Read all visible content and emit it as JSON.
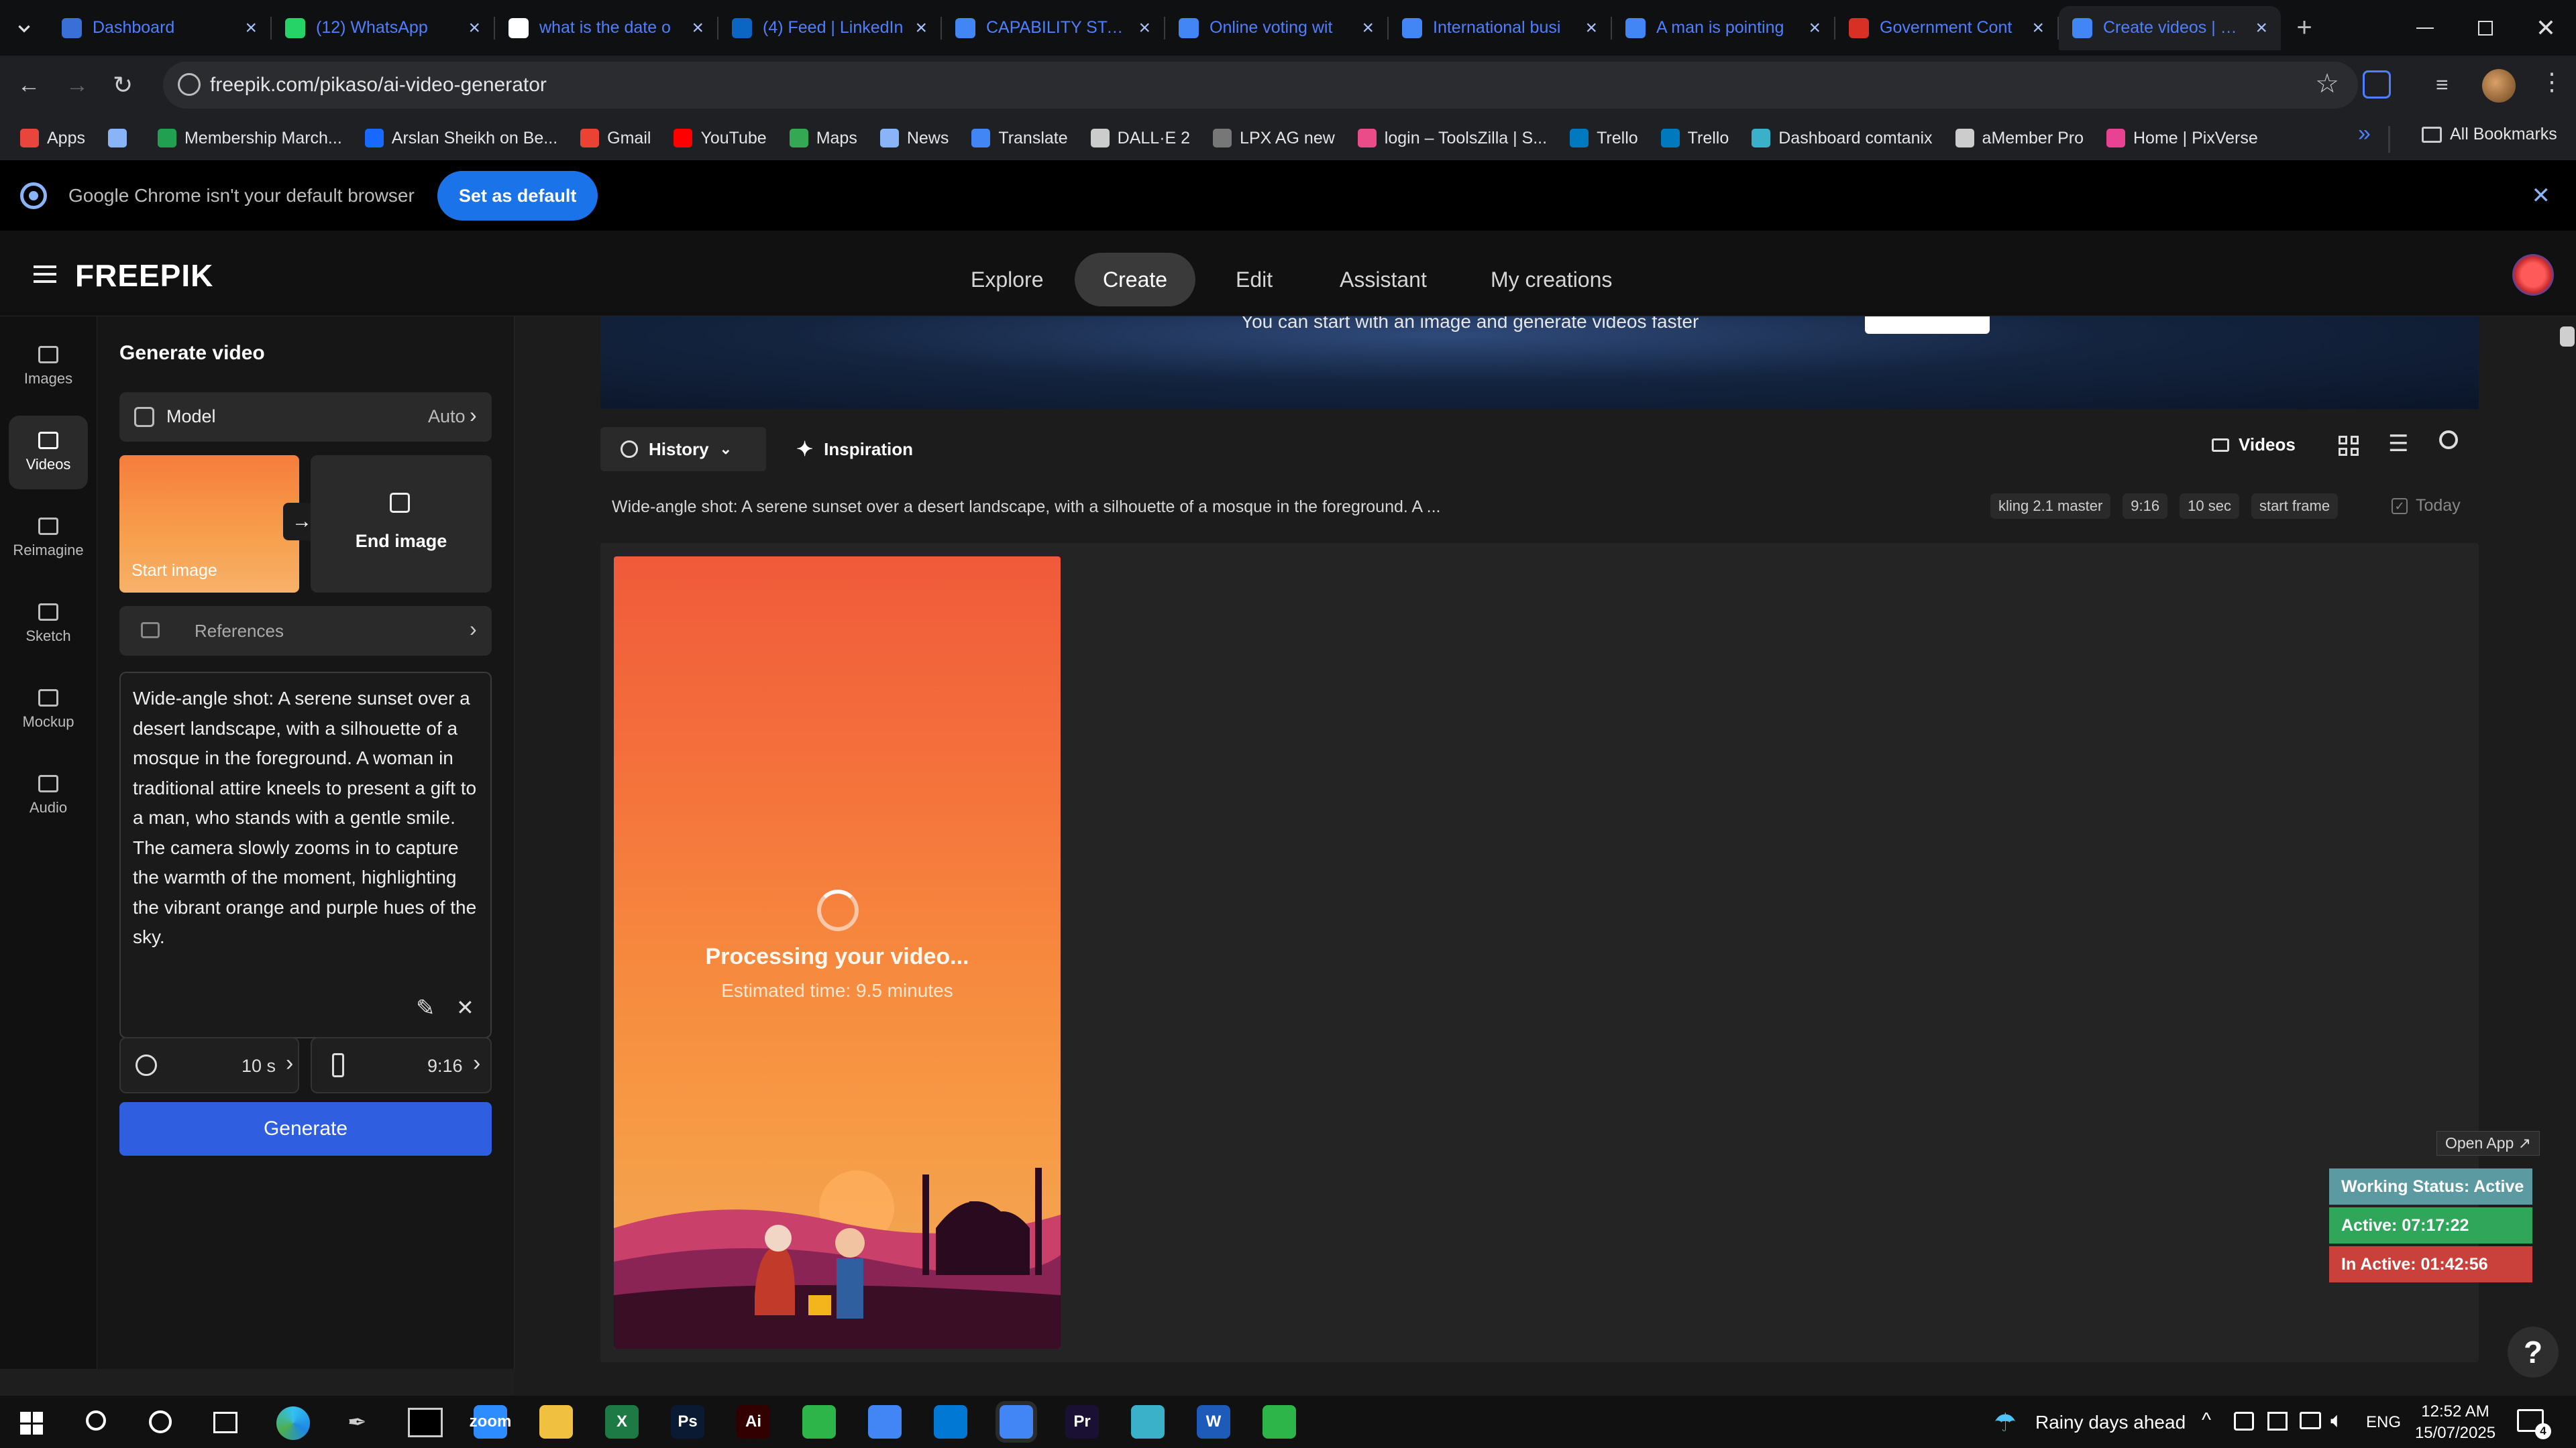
{
  "browser": {
    "tabs": [
      {
        "title": "Dashboard",
        "favicon_color": "#3b6fd8"
      },
      {
        "title": "(12) WhatsApp",
        "favicon_color": "#25d366"
      },
      {
        "title": "what is the date o",
        "favicon_color": "#ffffff"
      },
      {
        "title": "(4) Feed | LinkedIn",
        "favicon_color": "#0a66c2"
      },
      {
        "title": "CAPABILITY STATE",
        "favicon_color": "#4285f4"
      },
      {
        "title": "Online voting wit",
        "favicon_color": "#4285f4"
      },
      {
        "title": "International busi",
        "favicon_color": "#4285f4"
      },
      {
        "title": "A man is pointing",
        "favicon_color": "#4285f4"
      },
      {
        "title": "Government Cont",
        "favicon_color": "#d93025"
      },
      {
        "title": "Create videos | Fre",
        "favicon_color": "#4285f4"
      }
    ],
    "url": "freepik.com/pikaso/ai-video-generator",
    "bookmarks": [
      {
        "label": "Apps",
        "color": "#e8453c"
      },
      {
        "label": "",
        "color": "#8ab4f8"
      },
      {
        "label": "Membership March...",
        "color": "#22a052"
      },
      {
        "label": "Arslan Sheikh on Be...",
        "color": "#1769ff"
      },
      {
        "label": "Gmail",
        "color": "#ea4335"
      },
      {
        "label": "YouTube",
        "color": "#ff0000"
      },
      {
        "label": "Maps",
        "color": "#34a853"
      },
      {
        "label": "News",
        "color": "#8ab4f8"
      },
      {
        "label": "Translate",
        "color": "#4285f4"
      },
      {
        "label": "DALL·E 2",
        "color": "#cccccc"
      },
      {
        "label": "LPX AG new",
        "color": "#777777"
      },
      {
        "label": "login – ToolsZilla | S...",
        "color": "#e94c89"
      },
      {
        "label": "Trello",
        "color": "#0079bf"
      },
      {
        "label": "Trello",
        "color": "#0079bf"
      },
      {
        "label": "Dashboard comtanix",
        "color": "#3ab0c9"
      },
      {
        "label": "aMember Pro",
        "color": "#cccccc"
      },
      {
        "label": "Home | PixVerse",
        "color": "#e84393"
      }
    ],
    "all_bookmarks": "All Bookmarks",
    "notice_text": "Google Chrome isn't your default browser",
    "notice_button": "Set as default"
  },
  "header": {
    "logo": "FREEPIK",
    "nav": [
      "Explore",
      "Create",
      "Edit",
      "Assistant",
      "My creations"
    ],
    "active_nav": "Create"
  },
  "rail": [
    {
      "label": "Images",
      "icon": "image-icon"
    },
    {
      "label": "Videos",
      "icon": "video-icon"
    },
    {
      "label": "Reimagine",
      "icon": "reimagine-icon"
    },
    {
      "label": "Sketch",
      "icon": "brush-icon"
    },
    {
      "label": "Mockup",
      "icon": "mockup-icon"
    },
    {
      "label": "Audio",
      "icon": "audio-icon"
    }
  ],
  "panel": {
    "title": "Generate video",
    "model_label": "Model",
    "model_value": "Auto",
    "start_image": "Start image",
    "end_image": "End image",
    "references": "References",
    "prompt": "Wide-angle shot: A serene sunset over a desert landscape, with a silhouette of a mosque in the foreground. A woman in traditional attire kneels to present a gift to a man, who stands with a gentle smile. The camera slowly zooms in to capture the warmth of the moment, highlighting the vibrant orange and purple hues of the sky.",
    "duration": "10 s",
    "aspect": "9:16",
    "generate": "Generate"
  },
  "main": {
    "banner_text": "You can start with an image and generate videos faster",
    "history": "History",
    "inspiration": "Inspiration",
    "videos": "Videos",
    "item_prompt": "Wide-angle shot: A serene sunset over a desert landscape, with a silhouette of a mosque in the foreground. A ...",
    "chips": [
      "kling 2.1 master",
      "9:16",
      "10 sec",
      "start frame"
    ],
    "date": "Today",
    "processing": "Processing your video...",
    "estimate": "Estimated time: 9.5 minutes"
  },
  "widget": {
    "open_app": "Open App ↗",
    "status": "Working Status: Active",
    "active": "Active: 07:17:22",
    "inactive": "In Active: 01:42:56",
    "colors": {
      "status": "#5b9aa0",
      "active": "#2fa65a",
      "inactive": "#c9413a"
    }
  },
  "taskbar": {
    "weather": "Rainy days ahead",
    "lang": "ENG",
    "time": "12:52 AM",
    "date": "15/07/2025",
    "notif_count": "4",
    "apps": [
      {
        "name": "zoom",
        "label": "zoom",
        "color": "#2d8cff"
      },
      {
        "name": "explorer",
        "label": "",
        "color": "#f0c040"
      },
      {
        "name": "excel",
        "label": "X",
        "color": "#1d7a45"
      },
      {
        "name": "photoshop",
        "label": "Ps",
        "color": "#0b1a33"
      },
      {
        "name": "illustrator",
        "label": "Ai",
        "color": "#330000"
      },
      {
        "name": "app-green",
        "label": "",
        "color": "#2db54a"
      },
      {
        "name": "chrome",
        "label": "",
        "color": "#4285f4"
      },
      {
        "name": "vscode",
        "label": "",
        "color": "#0078d4"
      },
      {
        "name": "chrome-active",
        "label": "",
        "color": "#4285f4"
      },
      {
        "name": "premiere",
        "label": "Pr",
        "color": "#1a1033"
      },
      {
        "name": "app-blue",
        "label": "",
        "color": "#3ab0c9"
      },
      {
        "name": "word",
        "label": "W",
        "color": "#1e5bb8"
      },
      {
        "name": "app-green2",
        "label": "",
        "color": "#2db54a"
      }
    ]
  }
}
